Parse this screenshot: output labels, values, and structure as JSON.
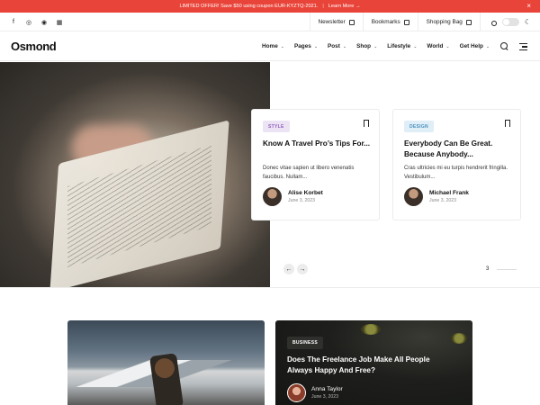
{
  "promo": {
    "text": "LIMITED OFFER! Save $50 using coupon EUR-KYZTQ-2021.",
    "separator": "|",
    "link": "Learn More →",
    "close": "×"
  },
  "utility": {
    "socials": [
      "f",
      "◎",
      "◉",
      "▦"
    ],
    "newsletter": "Newsletter",
    "bookmarks": "Bookmarks",
    "shopping_bag": "Shopping Bag",
    "moon": "☾"
  },
  "header": {
    "logo": "Osmond",
    "nav": [
      {
        "label": "Home",
        "chev": "⌄"
      },
      {
        "label": "Pages",
        "chev": "⌄"
      },
      {
        "label": "Post",
        "chev": "⌄"
      },
      {
        "label": "Shop",
        "chev": "⌄"
      },
      {
        "label": "Lifestyle",
        "chev": "⌄"
      },
      {
        "label": "World",
        "chev": "⌄"
      },
      {
        "label": "Get Help",
        "chev": "⌄"
      }
    ]
  },
  "hero": {
    "cards": [
      {
        "tag": "STYLE",
        "tag_bg": "#ece3f5",
        "tag_color": "#8f5fb8",
        "title": "Know A Travel Pro’s Tips For...",
        "excerpt": "Donec vitae sapien ut libero venenatis faucibus. Nullam...",
        "author": "Alise Korbet",
        "date": "June 3, 2023"
      },
      {
        "tag": "DESIGN",
        "tag_bg": "#e0eef7",
        "tag_color": "#4a8fbf",
        "title": "Everybody Can Be Great. Because Anybody...",
        "excerpt": "Cras ultricies mi eu turpis hendrerit fringilla. Vestibulum...",
        "author": "Michael Frank",
        "date": "June 3, 2023"
      }
    ],
    "prev": "←",
    "next": "→",
    "page": "3"
  },
  "featured": {
    "tag": "BUSINESS",
    "title": "Does The Freelance Job Make All People Always Happy And Free?",
    "author": "Anna Taylor",
    "date": "June 3, 2023"
  },
  "colors": {
    "promo_bg": "#e9443a"
  }
}
